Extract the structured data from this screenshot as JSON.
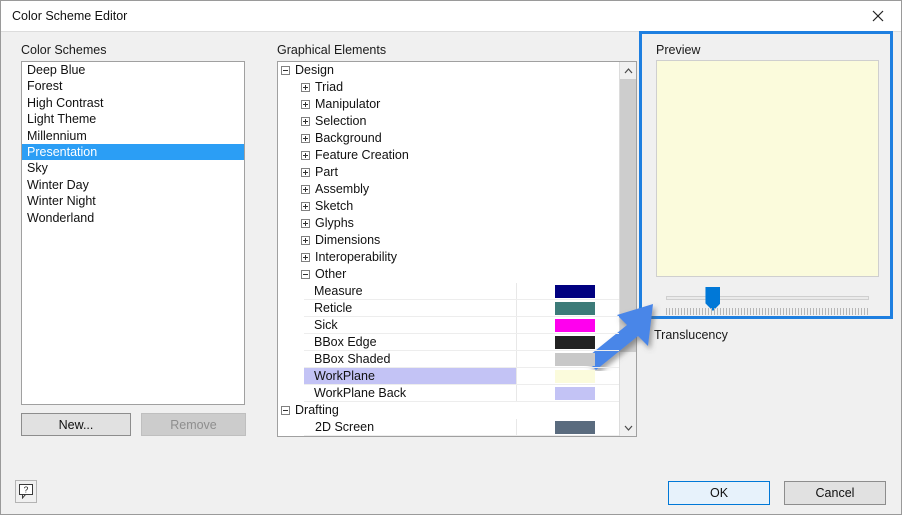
{
  "window": {
    "title": "Color Scheme Editor",
    "close_icon": "close-icon"
  },
  "left_panel": {
    "label": "Color Schemes",
    "items": [
      {
        "label": "Deep Blue",
        "selected": false
      },
      {
        "label": "Forest",
        "selected": false
      },
      {
        "label": "High Contrast",
        "selected": false
      },
      {
        "label": "Light Theme",
        "selected": false
      },
      {
        "label": "Millennium",
        "selected": false
      },
      {
        "label": "Presentation",
        "selected": true
      },
      {
        "label": "Sky",
        "selected": false
      },
      {
        "label": "Winter Day",
        "selected": false
      },
      {
        "label": "Winter Night",
        "selected": false
      },
      {
        "label": "Wonderland",
        "selected": false
      }
    ],
    "new_button": "New...",
    "remove_button": "Remove",
    "remove_disabled": true,
    "selection_color": "#2b9ef5"
  },
  "help": {
    "icon": "help-question-icon",
    "label": "?"
  },
  "tree_panel": {
    "label": "Graphical Elements",
    "rows": [
      {
        "label": "Design",
        "depth": 0,
        "expander": "minus",
        "swatch": null,
        "selected": false
      },
      {
        "label": "Triad",
        "depth": 1,
        "expander": "plus",
        "swatch": null,
        "selected": false
      },
      {
        "label": "Manipulator",
        "depth": 1,
        "expander": "plus",
        "swatch": null,
        "selected": false
      },
      {
        "label": "Selection",
        "depth": 1,
        "expander": "plus",
        "swatch": null,
        "selected": false
      },
      {
        "label": "Background",
        "depth": 1,
        "expander": "plus",
        "swatch": null,
        "selected": false
      },
      {
        "label": "Feature Creation",
        "depth": 1,
        "expander": "plus",
        "swatch": null,
        "selected": false
      },
      {
        "label": "Part",
        "depth": 1,
        "expander": "plus",
        "swatch": null,
        "selected": false
      },
      {
        "label": "Assembly",
        "depth": 1,
        "expander": "plus",
        "swatch": null,
        "selected": false
      },
      {
        "label": "Sketch",
        "depth": 1,
        "expander": "plus",
        "swatch": null,
        "selected": false
      },
      {
        "label": "Glyphs",
        "depth": 1,
        "expander": "plus",
        "swatch": null,
        "selected": false
      },
      {
        "label": "Dimensions",
        "depth": 1,
        "expander": "plus",
        "swatch": null,
        "selected": false
      },
      {
        "label": "Interoperability",
        "depth": 1,
        "expander": "plus",
        "swatch": null,
        "selected": false
      },
      {
        "label": "Other",
        "depth": 1,
        "expander": "minus",
        "swatch": null,
        "selected": false
      },
      {
        "label": "Measure",
        "depth": 2,
        "expander": null,
        "swatch": "#000080",
        "selected": false
      },
      {
        "label": "Reticle",
        "depth": 2,
        "expander": null,
        "swatch": "#3d7b79",
        "selected": false
      },
      {
        "label": "Sick",
        "depth": 2,
        "expander": null,
        "swatch": "#ff00ee",
        "selected": false
      },
      {
        "label": "BBox Edge",
        "depth": 2,
        "expander": null,
        "swatch": "#222222",
        "selected": false
      },
      {
        "label": "BBox Shaded",
        "depth": 2,
        "expander": null,
        "swatch": "#c8c8c8",
        "selected": false
      },
      {
        "label": "WorkPlane",
        "depth": 2,
        "expander": null,
        "swatch": "#fbfbdc",
        "selected": true
      },
      {
        "label": "WorkPlane Back",
        "depth": 2,
        "expander": null,
        "swatch": "#c3c3f5",
        "selected": false
      },
      {
        "label": "Drafting",
        "depth": 0,
        "expander": "minus",
        "swatch": null,
        "selected": false
      },
      {
        "label": "2D Screen",
        "depth": 1,
        "expander": null,
        "swatch": "#5a6b7e",
        "selected": false
      }
    ],
    "row_selection_color": "#c3c3f5",
    "scrollbar": {
      "up_icon": "chevron-up-icon",
      "down_icon": "chevron-down-icon"
    }
  },
  "preview": {
    "label": "Preview",
    "swatch_color": "#fbfbdc",
    "highlight_border_color": "#1e7fe0",
    "translucency_label": "Translucency",
    "slider_value_percent": 21
  },
  "annotation": {
    "arrow_color": "#4a86e8",
    "arrow_icon": "pointer-arrow-icon"
  },
  "footer": {
    "ok_label": "OK",
    "cancel_label": "Cancel"
  }
}
